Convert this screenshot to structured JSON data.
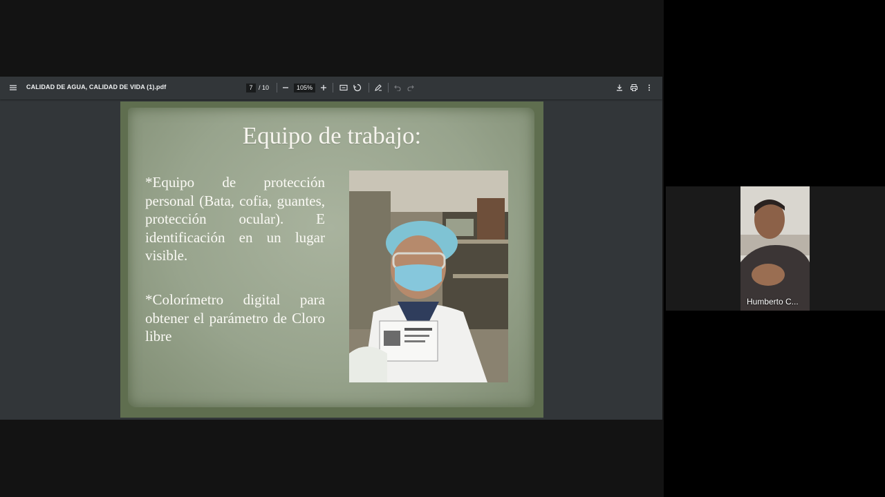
{
  "pdf_viewer": {
    "document_title": "CALIDAD DE AGUA, CALIDAD DE VIDA (1).pdf",
    "current_page": "7",
    "total_pages": "/ 10",
    "zoom_level": "105%",
    "icons": {
      "menu": "menu-icon",
      "zoom_out": "minus-icon",
      "zoom_in": "plus-icon",
      "fit": "fit-page-icon",
      "rotate": "rotate-icon",
      "annotate": "pen-icon",
      "undo": "undo-icon",
      "redo": "redo-icon",
      "download": "download-icon",
      "print": "print-icon",
      "more": "more-vert-icon"
    }
  },
  "slide": {
    "title": "Equipo de trabajo:",
    "bullet_1": "*Equipo de protección personal (Bata, cofia, guantes, protección ocular). E identificación en un lugar visible.",
    "bullet_2": "*Colorímetro digital para obtener el parámetro de Cloro libre"
  },
  "participant": {
    "name": "Humberto C..."
  },
  "colors": {
    "toolbar": "#323639",
    "slide_border": "#5f6e4f",
    "slide_fill": "#98a48d"
  }
}
